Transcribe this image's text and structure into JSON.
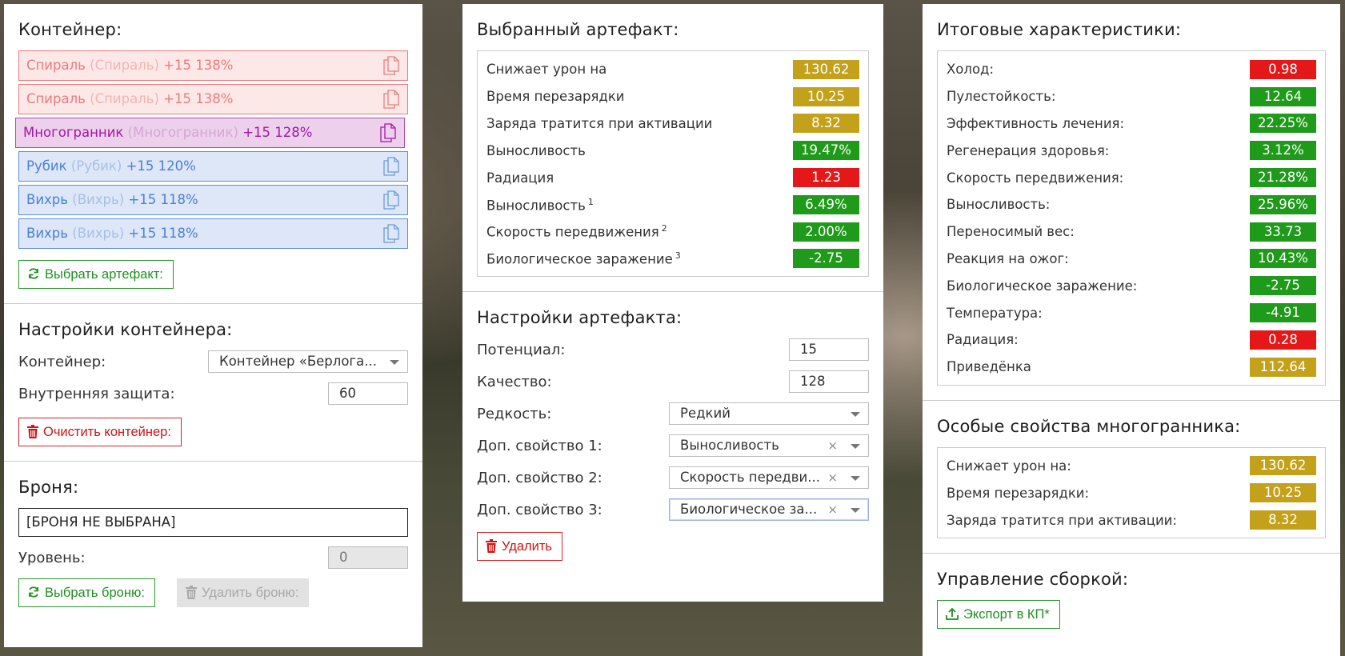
{
  "container_panel": {
    "title": "Контейнер:",
    "slots": [
      {
        "name": "Спираль",
        "sub": "(Спираль)",
        "bonus": "+15 138%",
        "variant": "red"
      },
      {
        "name": "Спираль",
        "sub": "(Спираль)",
        "bonus": "+15 138%",
        "variant": "red"
      },
      {
        "name": "Многогранник",
        "sub": "(Многогранник)",
        "bonus": "+15 128%",
        "variant": "purple"
      },
      {
        "name": "Рубик",
        "sub": "(Рубик)",
        "bonus": "+15 120%",
        "variant": "blue"
      },
      {
        "name": "Вихрь",
        "sub": "(Вихрь)",
        "bonus": "+15 118%",
        "variant": "blue"
      },
      {
        "name": "Вихрь",
        "sub": "(Вихрь)",
        "bonus": "+15 118%",
        "variant": "blue"
      }
    ],
    "select_button": "Выбрать артефакт:"
  },
  "container_settings": {
    "title": "Настройки контейнера:",
    "container_label": "Контейнер:",
    "container_value": "Контейнер «Берлога...",
    "protection_label": "Внутренняя защита:",
    "protection_value": "60",
    "clear_button": "Очистить контейнер:"
  },
  "armor": {
    "title": "Броня:",
    "value": "[БРОНЯ НЕ ВЫБРАНА]",
    "level_label": "Уровень:",
    "level_value": "0",
    "select_button": "Выбрать броню:",
    "delete_button": "Удалить броню:"
  },
  "selected_artifact": {
    "title": "Выбранный артефакт:",
    "stats": [
      {
        "label": "Снижает урон на",
        "sup": "",
        "value": "130.62",
        "color": "gold"
      },
      {
        "label": "Время перезарядки",
        "sup": "",
        "value": "10.25",
        "color": "gold"
      },
      {
        "label": "Заряда тратится при активации",
        "sup": "",
        "value": "8.32",
        "color": "gold"
      },
      {
        "label": "Выносливость",
        "sup": "",
        "value": "19.47%",
        "color": "green"
      },
      {
        "label": "Радиация",
        "sup": "",
        "value": "1.23",
        "color": "red"
      },
      {
        "label": "Выносливость",
        "sup": "1",
        "value": "6.49%",
        "color": "green"
      },
      {
        "label": "Скорость передвижения",
        "sup": "2",
        "value": "2.00%",
        "color": "green"
      },
      {
        "label": "Биологическое заражение",
        "sup": "3",
        "value": "-2.75",
        "color": "green"
      }
    ]
  },
  "artifact_settings": {
    "title": "Настройки артефакта:",
    "potential_label": "Потенциал:",
    "potential_value": "15",
    "quality_label": "Качество:",
    "quality_value": "128",
    "rarity_label": "Редкость:",
    "rarity_value": "Редкий",
    "extra1_label": "Доп. свойство 1:",
    "extra1_value": "Выносливость",
    "extra2_label": "Доп. свойство 2:",
    "extra2_value": "Скорость передви...",
    "extra3_label": "Доп. свойство 3:",
    "extra3_value": "Биологическое за...",
    "clear_glyph": "×",
    "delete_button": "Удалить"
  },
  "totals": {
    "title": "Итоговые характеристики:",
    "stats": [
      {
        "label": "Холод:",
        "value": "0.98",
        "color": "red"
      },
      {
        "label": "Пулестойкость:",
        "value": "12.64",
        "color": "green"
      },
      {
        "label": "Эффективность лечения:",
        "value": "22.25%",
        "color": "green"
      },
      {
        "label": "Регенерация здоровья:",
        "value": "3.12%",
        "color": "green"
      },
      {
        "label": "Скорость передвижения:",
        "value": "21.28%",
        "color": "green"
      },
      {
        "label": "Выносливость:",
        "value": "25.96%",
        "color": "green"
      },
      {
        "label": "Переносимый вес:",
        "value": "33.73",
        "color": "green"
      },
      {
        "label": "Реакция на ожог:",
        "value": "10.43%",
        "color": "green"
      },
      {
        "label": "Биологическое заражение:",
        "value": "-2.75",
        "color": "green"
      },
      {
        "label": "Температура:",
        "value": "-4.91",
        "color": "green"
      },
      {
        "label": "Радиация:",
        "value": "0.28",
        "color": "red"
      },
      {
        "label": "Приведёнка",
        "value": "112.64",
        "color": "gold"
      }
    ]
  },
  "special": {
    "title": "Особые свойства многогранника:",
    "stats": [
      {
        "label": "Снижает урон на:",
        "value": "130.62",
        "color": "gold"
      },
      {
        "label": "Время перезарядки:",
        "value": "10.25",
        "color": "gold"
      },
      {
        "label": "Заряда тратится при активации:",
        "value": "8.32",
        "color": "gold"
      }
    ]
  },
  "build": {
    "title": "Управление сборкой:",
    "export_button": "Экспорт в КП*"
  },
  "colors": {
    "gold": "#c4a11a",
    "green": "#1f9a1a",
    "red": "#e41818"
  }
}
